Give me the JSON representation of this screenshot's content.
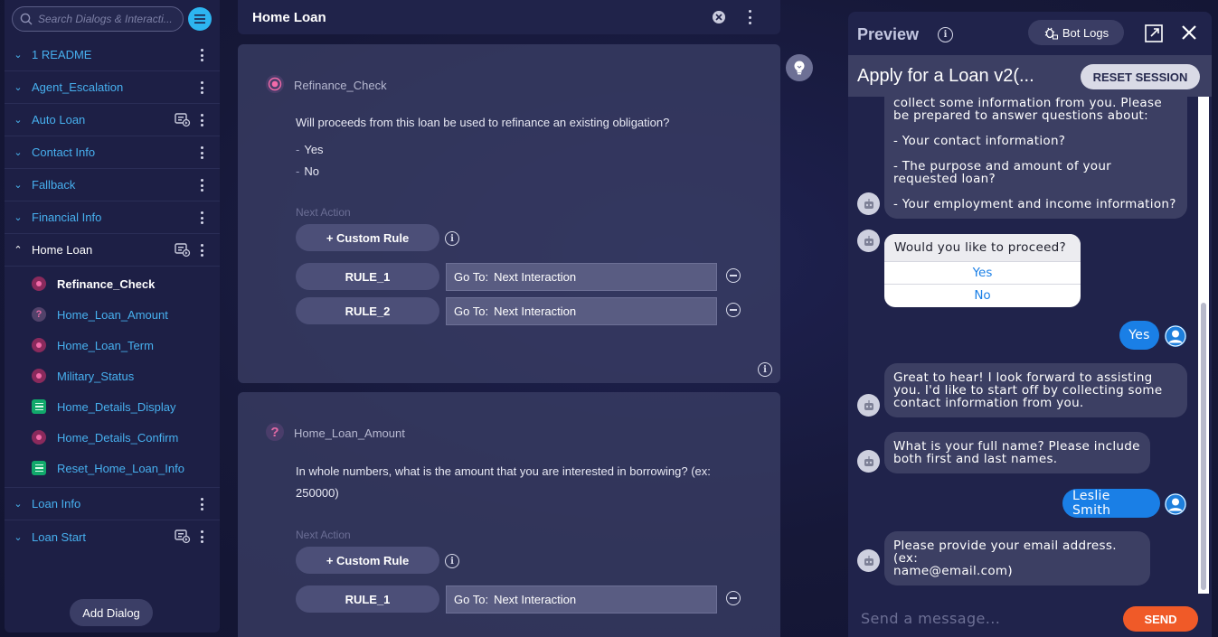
{
  "sidebar": {
    "search_placeholder": "Search Dialogs & Interacti...",
    "dialogs": [
      {
        "label": "1 README"
      },
      {
        "label": "Agent_Escalation"
      },
      {
        "label": "Auto Loan"
      },
      {
        "label": "Contact Info"
      },
      {
        "label": "Fallback"
      },
      {
        "label": "Financial Info"
      },
      {
        "label": "Home Loan"
      },
      {
        "label": "Loan Info"
      },
      {
        "label": "Loan Start"
      }
    ],
    "home_loan_interactions": [
      {
        "label": "Refinance_Check",
        "icon": "radio-icon"
      },
      {
        "label": "Home_Loan_Amount",
        "icon": "question-icon"
      },
      {
        "label": "Home_Loan_Term",
        "icon": "radio-icon"
      },
      {
        "label": "Military_Status",
        "icon": "radio-icon"
      },
      {
        "label": "Home_Details_Display",
        "icon": "list-icon"
      },
      {
        "label": "Home_Details_Confirm",
        "icon": "radio-icon"
      },
      {
        "label": "Reset_Home_Loan_Info",
        "icon": "list-icon"
      }
    ],
    "add_dialog_label": "Add Dialog"
  },
  "main": {
    "title": "Home Loan",
    "cards": [
      {
        "name": "Refinance_Check",
        "prompt": "Will proceeds from this loan be used to refinance an existing obligation?",
        "options": [
          "Yes",
          "No"
        ],
        "next_action_label": "Next Action",
        "custom_rule_label": "+ Custom Rule",
        "rules": [
          {
            "name": "RULE_1",
            "goto_label": "Go To:",
            "goto_value": "Next Interaction"
          },
          {
            "name": "RULE_2",
            "goto_label": "Go To:",
            "goto_value": "Next Interaction"
          }
        ]
      },
      {
        "name": "Home_Loan_Amount",
        "prompt": "In whole numbers, what is the amount that you are interested in borrowing?  (ex: 250000)",
        "next_action_label": "Next Action",
        "custom_rule_label": "+ Custom Rule",
        "rules": [
          {
            "name": "RULE_1",
            "goto_label": "Go To:",
            "goto_value": "Next Interaction"
          }
        ]
      }
    ]
  },
  "preview": {
    "title": "Preview",
    "bot_logs_label": "Bot Logs",
    "flow_name": "Apply for a Loan v2(...",
    "reset_label": "RESET SESSION",
    "messages": {
      "m1_lines": [
        "collect some information from you. Please",
        "be prepared to answer questions about:",
        "",
        "- Your contact information?",
        "",
        "- The purpose and amount of your",
        "requested loan?",
        "",
        "- Your employment and income information?"
      ],
      "quick_reply_question": "Would you like to proceed?",
      "quick_reply_options": [
        "Yes",
        "No"
      ],
      "user_1": "Yes",
      "m2_lines": [
        "Great to hear! I look forward to assisting",
        "you. I'd like to start off by collecting some",
        "contact information from you."
      ],
      "m3_lines": [
        "What is your full name? Please include",
        "both first and last names."
      ],
      "user_2": "Leslie Smith",
      "m4_lines": [
        "Please provide your email address. (ex:",
        "name@email.com)"
      ]
    },
    "input_placeholder": "Send a message...",
    "send_label": "SEND"
  },
  "colors": {
    "accent_blue": "#47b0ef",
    "send_orange": "#f05a28",
    "user_bubble": "#1a7fe6",
    "radio_pink": "#f26aa9",
    "list_green": "#11a86b"
  }
}
